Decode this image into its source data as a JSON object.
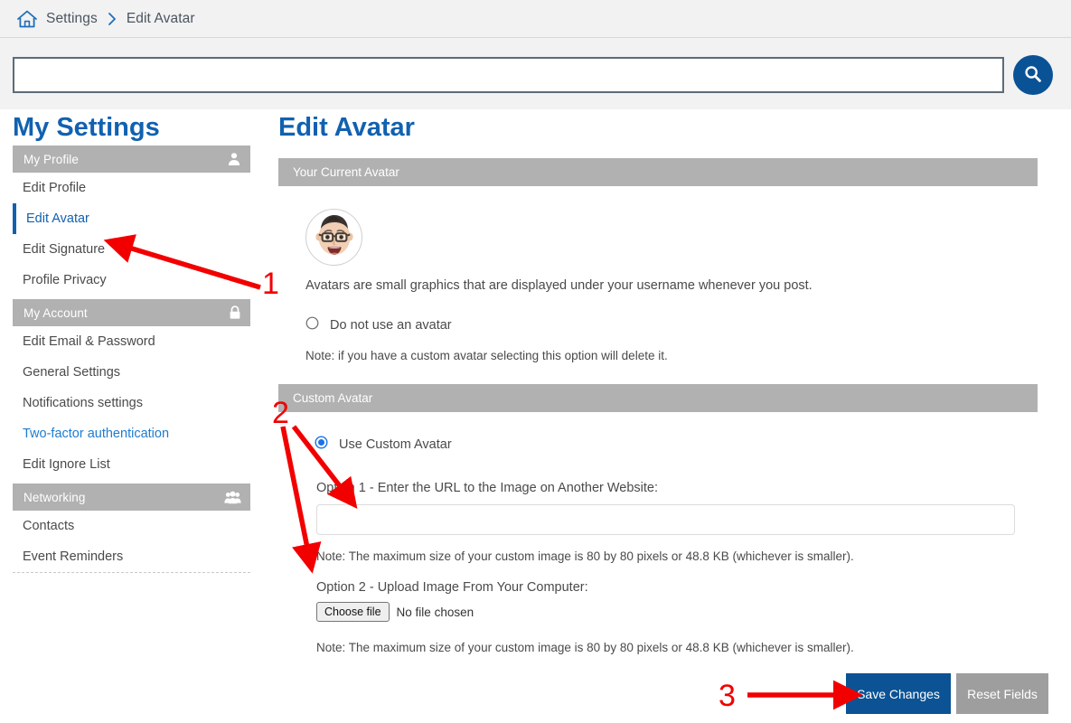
{
  "breadcrumb": {
    "home_icon": "home-icon",
    "separator": "chevron-right-icon",
    "items": [
      "Settings",
      "Edit Avatar"
    ]
  },
  "search": {
    "value": "",
    "placeholder": "",
    "button_icon": "search-icon"
  },
  "sidebar": {
    "title": "My Settings",
    "groups": [
      {
        "header": "My Profile",
        "icon": "user-icon",
        "items": [
          {
            "label": "Edit Profile",
            "state": "normal"
          },
          {
            "label": "Edit Avatar",
            "state": "active"
          },
          {
            "label": "Edit Signature",
            "state": "normal"
          },
          {
            "label": "Profile Privacy",
            "state": "normal"
          }
        ]
      },
      {
        "header": "My Account",
        "icon": "lock-icon",
        "items": [
          {
            "label": "Edit Email & Password",
            "state": "normal"
          },
          {
            "label": "General Settings",
            "state": "normal"
          },
          {
            "label": "Notifications settings",
            "state": "normal"
          },
          {
            "label": "Two-factor authentication",
            "state": "link"
          },
          {
            "label": "Edit Ignore List",
            "state": "normal"
          }
        ]
      },
      {
        "header": "Networking",
        "icon": "users-group-icon",
        "items": [
          {
            "label": "Contacts",
            "state": "normal"
          },
          {
            "label": "Event Reminders",
            "state": "normal"
          }
        ]
      }
    ]
  },
  "main": {
    "title": "Edit Avatar",
    "current_avatar_panel": {
      "header": "Your Current Avatar",
      "avatar_icon": "memoji-face-avatar",
      "caption": "Avatars are small graphics that are displayed under your username whenever you post.",
      "no_avatar_option": {
        "label": "Do not use an avatar",
        "selected": false
      },
      "no_avatar_note": "Note: if you have a custom avatar selecting this option will delete it."
    },
    "custom_avatar_panel": {
      "header": "Custom Avatar",
      "use_custom_option": {
        "label": "Use Custom Avatar",
        "selected": true
      },
      "option1_label": "Option 1 - Enter the URL to the Image on Another Website:",
      "url_value": "",
      "url_placeholder": "",
      "option1_note": "Note: The maximum size of your custom image is 80 by 80 pixels or 48.8 KB (whichever is smaller).",
      "option2_label": "Option 2 - Upload Image From Your Computer:",
      "choose_file_label": "Choose file",
      "file_status": "No file chosen",
      "option2_note": "Note: The maximum size of your custom image is 80 by 80 pixels or 48.8 KB (whichever is smaller)."
    },
    "buttons": {
      "save_label": "Save Changes",
      "reset_label": "Reset Fields"
    }
  },
  "annotations": {
    "color": "#f20000",
    "markers": [
      {
        "number": "1",
        "target": "sidebar-item-edit-avatar"
      },
      {
        "number": "2",
        "target": "custom-avatar-url-input-and-file-upload"
      },
      {
        "number": "3",
        "target": "save-changes-button"
      }
    ]
  },
  "colors": {
    "brand_blue": "#1161b0",
    "dark_blue": "#0b5394",
    "panel_gray": "#b1b1b1",
    "annotation_red": "#f20000"
  }
}
